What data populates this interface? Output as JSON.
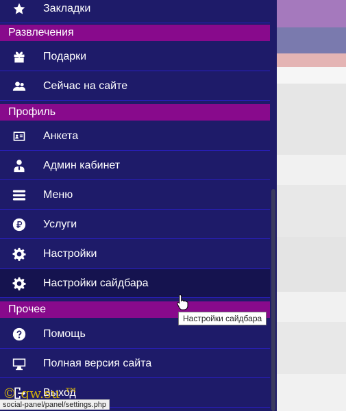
{
  "sections": {
    "entertainment": "Развлечения",
    "profile": "Профиль",
    "other": "Прочее"
  },
  "items": {
    "bookmarks": "Закладки",
    "gifts": "Подарки",
    "online_now": "Сейчас на сайте",
    "questionnaire": "Анкета",
    "admin_cabinet": "Админ кабинет",
    "menu": "Меню",
    "services": "Услуги",
    "settings": "Настройки",
    "sidebar_settings": "Настройки сайдбара",
    "help": "Помощь",
    "full_version": "Полная версия сайта",
    "logout": "Выход"
  },
  "tooltip": "Настройки сайдбара",
  "status_url": "social-panel/panel/settings.php",
  "watermark": "© gw.su ™",
  "icons": [
    "star-icon",
    "gift-icon",
    "users-icon",
    "id-card-icon",
    "admin-user-icon",
    "bars-icon",
    "ruble-icon",
    "gear-icon",
    "gear-icon",
    "question-icon",
    "desktop-icon",
    "logout-icon"
  ],
  "colors": {
    "sidebar_bg": "#1e1b69",
    "section_bg": "#880a8c",
    "active_bg": "#15134f",
    "divider": "#2a1fc4"
  }
}
